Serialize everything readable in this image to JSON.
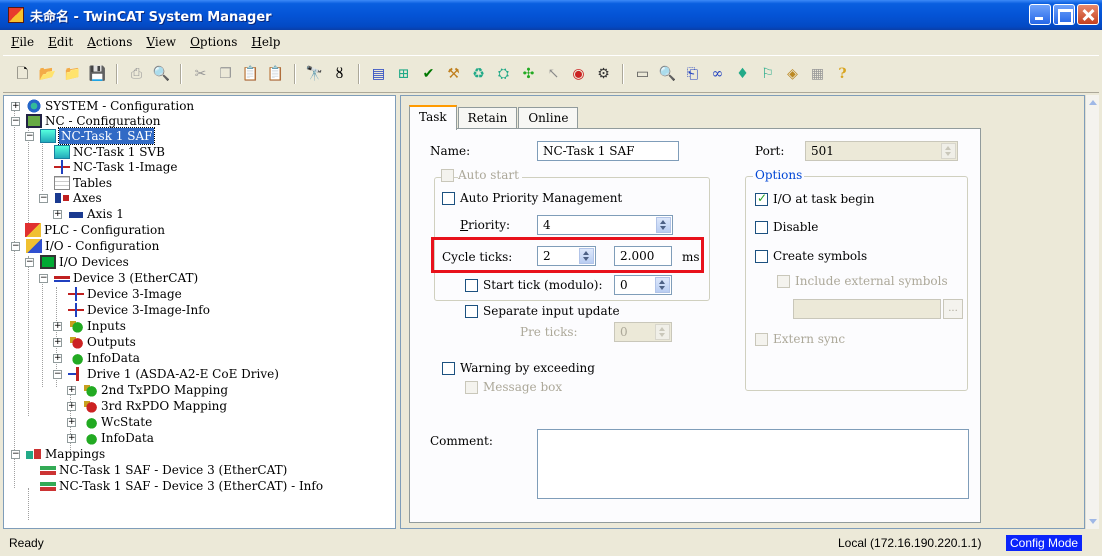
{
  "window": {
    "title": "未命名 - TwinCAT System Manager"
  },
  "menu": [
    "File",
    "Edit",
    "Actions",
    "View",
    "Options",
    "Help"
  ],
  "toolbar_icons": [
    "new-icon",
    "open-icon",
    "open-folder-icon",
    "save-icon",
    "print-icon",
    "print-preview-icon",
    "cut-icon",
    "copy-icon",
    "paste-icon",
    "paste-special-icon",
    "find-icon",
    "find-next-icon",
    "generate-mappings-icon",
    "check-config-icon",
    "activate-config-icon",
    "set-run-mode-icon",
    "restart-icon",
    "login-icon",
    "scan-devices-icon",
    "target-icon",
    "toggle-free-run-icon",
    "zoom-icon",
    "network-icon",
    "goggles-icon",
    "marker-icon",
    "online-icon",
    "help-2-icon",
    "about-icon",
    "help-icon"
  ],
  "tree": {
    "system": "SYSTEM - Configuration",
    "nc": "NC - Configuration",
    "nc_task": "NC-Task 1 SAF",
    "nc_task_svb": "NC-Task 1 SVB",
    "nc_task_image": "NC-Task 1-Image",
    "tables": "Tables",
    "axes": "Axes",
    "axis1": "Axis 1",
    "plc": "PLC - Configuration",
    "io": "I/O - Configuration",
    "io_devices": "I/O Devices",
    "device3": "Device 3 (EtherCAT)",
    "device3_image": "Device 3-Image",
    "device3_image_info": "Device 3-Image-Info",
    "inputs": "Inputs",
    "outputs": "Outputs",
    "infodata": "InfoData",
    "drive1": "Drive 1 (ASDA-A2-E CoE Drive)",
    "txpdo": "2nd TxPDO Mapping",
    "rxpdo": "3rd RxPDO Mapping",
    "wcstate": "WcState",
    "drive_infodata": "InfoData",
    "mappings": "Mappings",
    "mapping1": "NC-Task 1 SAF - Device 3 (EtherCAT)",
    "mapping2": "NC-Task 1 SAF - Device 3 (EtherCAT) - Info"
  },
  "tabs": [
    "Task",
    "Retain",
    "Online"
  ],
  "task": {
    "name_label": "Name:",
    "name_value": "NC-Task 1 SAF",
    "auto_start_label": "Auto start",
    "auto_priority_label": "Auto Priority Management",
    "priority_label": "Priority:",
    "priority_value": "4",
    "cycle_ticks_label": "Cycle ticks:",
    "cycle_ticks_value": "2",
    "cycle_ms_value": "2.000",
    "cycle_unit": "ms",
    "start_tick_label": "Start tick (modulo):",
    "start_tick_value": "0",
    "separate_input_label": "Separate input update",
    "pre_ticks_label": "Pre ticks:",
    "pre_ticks_value": "0",
    "warning_label": "Warning by exceeding",
    "message_box_label": "Message box",
    "port_label": "Port:",
    "port_value": "501",
    "options_title": "Options",
    "io_at_begin_label": "I/O at task begin",
    "io_at_begin_checked": true,
    "disable_label": "Disable",
    "create_symbols_label": "Create symbols",
    "include_external_label": "Include external symbols",
    "extern_sync_label": "Extern sync",
    "comment_label": "Comment:",
    "comment_value": "",
    "browse_label": "..."
  },
  "status": {
    "left": "Ready",
    "address": "Local (172.16.190.220.1.1)",
    "mode": "Config Mode"
  }
}
